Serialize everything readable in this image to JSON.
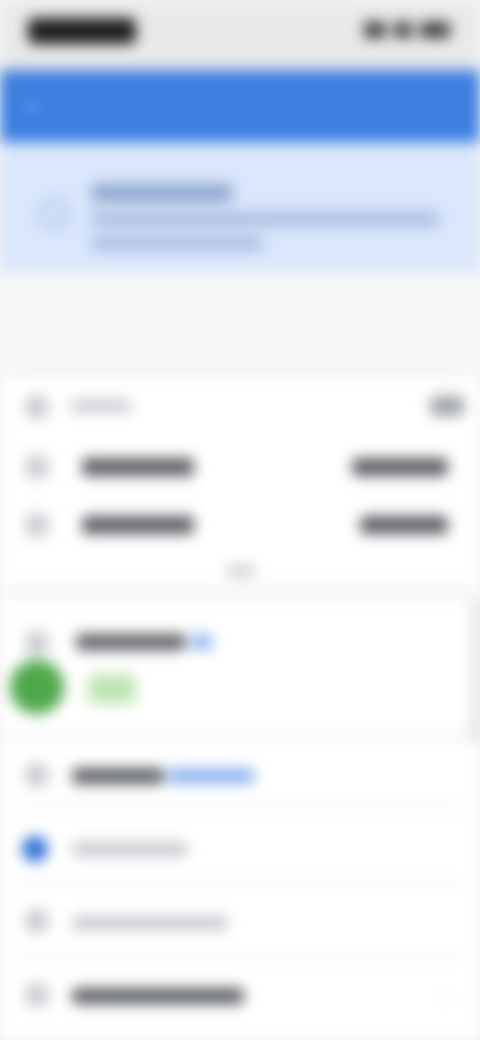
{
  "status_bar": {
    "time": "",
    "icons": [
      "signal-icon",
      "wifi-icon",
      "battery-icon"
    ]
  },
  "header": {
    "title": "",
    "back_icon": "back-arrow-icon",
    "bg_color": "#3d7fe0"
  },
  "banner": {
    "icon": "info-icon",
    "title": "",
    "line1": "",
    "line2": ""
  },
  "section": {
    "label": ""
  },
  "list": {
    "header_label": "",
    "header_action": "",
    "rows": [
      {
        "label": "",
        "value": ""
      },
      {
        "label": "",
        "value": ""
      }
    ],
    "footer": ""
  },
  "contacts": {
    "label": "",
    "tag": "",
    "chip": ""
  },
  "menu": [
    {
      "label": "",
      "link": ""
    },
    {
      "label": ""
    },
    {
      "label": ""
    },
    {
      "label": ""
    }
  ],
  "colors": {
    "accent": "#3d7fe0",
    "banner_bg": "#d9e6fb",
    "green": "#4ea84a"
  }
}
